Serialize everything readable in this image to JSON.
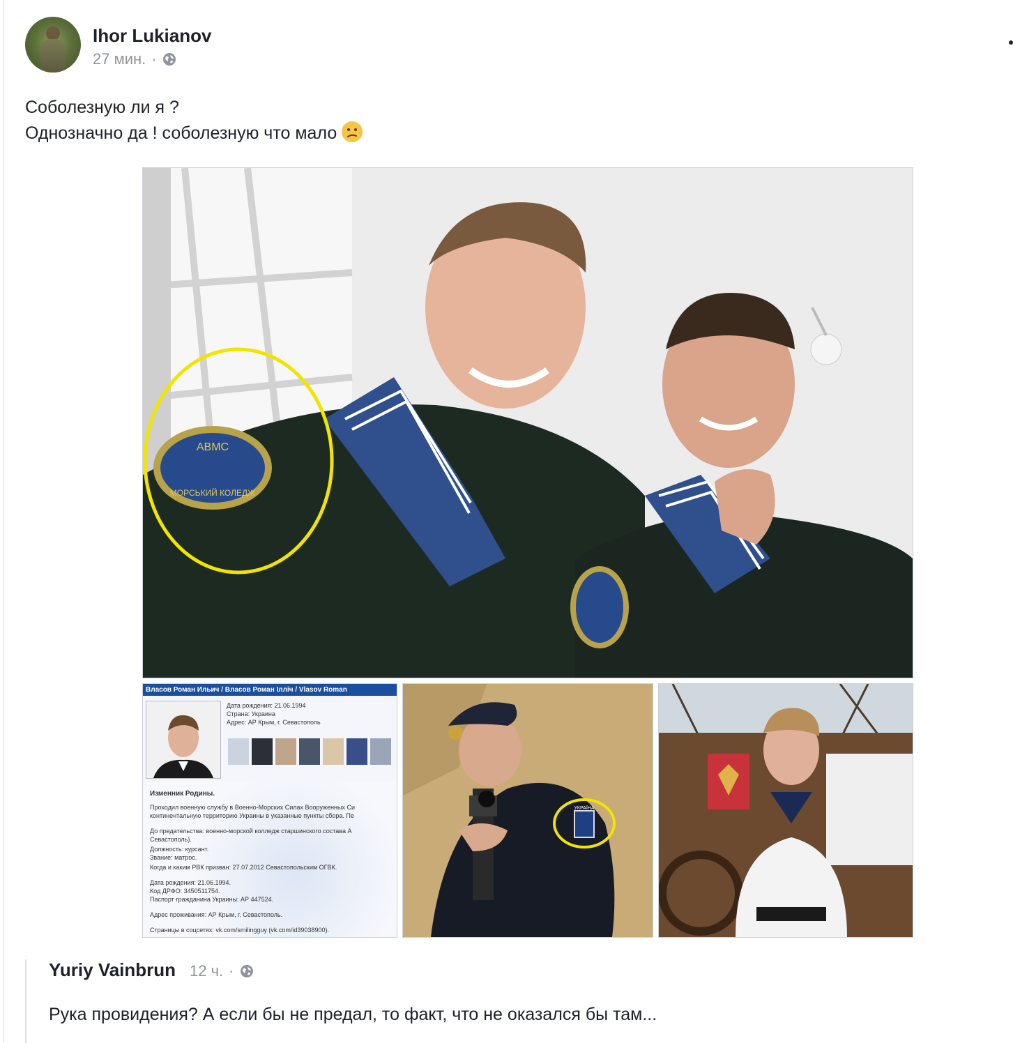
{
  "post": {
    "author": "Ihor Lukianov",
    "time": "27 мин.",
    "separator": "·",
    "privacy_icon": "globe-icon",
    "text_line1": "Соболезную ли я ?",
    "text_line2": "Однозначно да ! соболезную что мало",
    "emoji": "confused-face-emoji",
    "more_icon": "more-options-icon"
  },
  "photos": {
    "main": {
      "patch_text_top": "АВМС",
      "patch_text_bottom": "МОРСЬКИЙ КОЛЕДЖ",
      "highlight_color": "#f2e400"
    },
    "profile_card": {
      "header": "Власов Роман Ильич / Власов Роман Ілліч / Vlasov Roman",
      "birth_label": "Дата рождения: 21.06.1994",
      "country_label": "Страна: Украина",
      "address_label": "Адрес: АР Крым, г. Севастополь",
      "title": "Изменник Родины.",
      "line1": "Проходил военную службу в Военно-Морских Силах Вооруженных Си",
      "line2": "континентальную территорию Украины в указанные пункты сбора. Пе",
      "line3": "До предательства: военно-морской колледж старшинского состава А",
      "line4": "Севастополь).",
      "line5": "Должность: курсант.",
      "line6": "Звание: матрос.",
      "line7": "Когда и каким РВК призван: 27.07.2012 Севастопольским ОГВК.",
      "line8": "Дата рождения: 21.06.1994.",
      "line9": "Код ДРФО: 3450511754.",
      "line10": "Паспорт гражданина Украины: АР 447524.",
      "line11": "Адрес проживания: АР Крым, г. Севастополь.",
      "line12": "Страницы в соцсетях: vk.com/smilingguy (vk.com/id39038900)."
    },
    "soldier_patch_text": "УКРАЇНА"
  },
  "comment": {
    "author": "Yuriy Vainbrun",
    "time": "12 ч.",
    "separator": "·",
    "privacy_icon": "globe-icon",
    "text": "Рука провидения? А если бы не предал, то факт, что не оказался бы там..."
  },
  "colors": {
    "text": "#1d2129",
    "meta": "#90949c",
    "border": "#dddfe2"
  }
}
